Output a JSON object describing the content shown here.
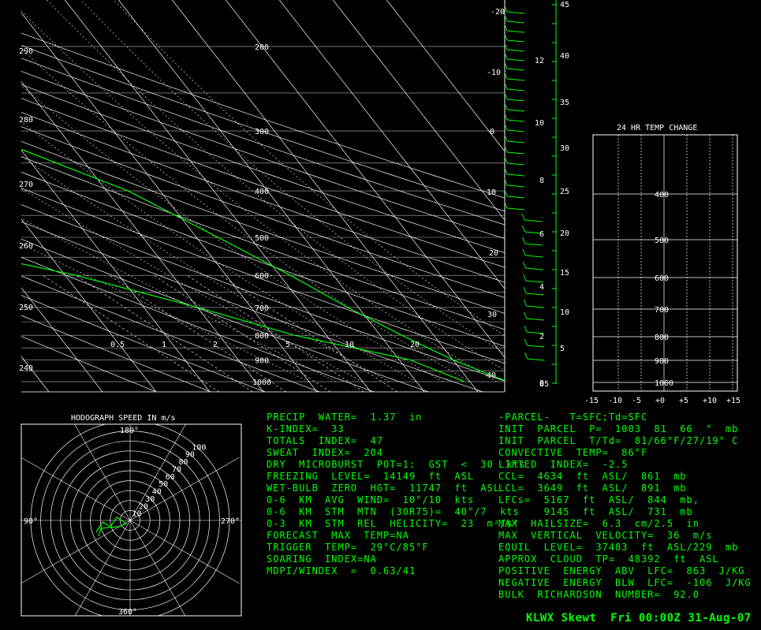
{
  "footer": "KLWX Skewt  Fri 00:00Z 31-Aug-07",
  "hodograph": {
    "title": "HODOGRAPH SPEED IN m/s",
    "dir_labels": [
      "180°",
      "90°",
      "270°",
      "360°"
    ],
    "ring_labels": [
      "10",
      "20",
      "30",
      "40",
      "50",
      "60",
      "70",
      "80",
      "90",
      "100"
    ]
  },
  "temp_change": {
    "title": "24 HR TEMP CHANGE",
    "pressure_labels": [
      "400",
      "500",
      "600",
      "700",
      "800",
      "900",
      "1000"
    ],
    "x_labels": [
      "-15",
      "-10",
      "-5",
      "+0",
      "+5",
      "+10",
      "+15"
    ]
  },
  "indices_left": [
    "PRECIP  WATER=  1.37  in",
    "K-INDEX=  33",
    "TOTALS  INDEX=  47",
    "SWEAT  INDEX=  204",
    "DRY  MICROBURST  POT=1:  GST  <  30  kts",
    "FREEZING  LEVEL=  14149  ft  ASL",
    "WET-BULB  ZERO  HGT=  11747  ft  ASL",
    "0-6  KM  AVG  WIND=  10°/10  kts",
    "0-6  KM  STM  MTN  (30R75)=  40°/7  kts",
    "0-3  KM  STM  REL  HELICITY=  23  m²/s²",
    "FORECAST  MAX  TEMP=NA",
    "TRIGGER  TEMP=  29°C/85°F",
    "SOARING  INDEX=NA",
    "MDPI/WINDEX  =  0.63/41"
  ],
  "indices_right": [
    "-PARCEL-   T=SFC;Td=SFC",
    "INIT  PARCEL  P=  1003  81  66  °  mb",
    "INIT  PARCEL  T/Td=  81/66°F/27/19° C",
    "CONVECTIVE  TEMP=  86°F",
    "LIFTED  INDEX=  -2.5",
    "CCL=  4634  ft  ASL/  861  mb",
    "LCL=  3649  ft  ASL/  891  mb",
    "LFCs=  5167  ft  ASL/  844  mb,",
    "       9145  ft  ASL/  731  mb",
    "MAX  HAILSIZE=  6.3  cm/2.5  in",
    "MAX  VERTICAL  VELOCITY=  36  m/s",
    "EQUIL  LEVEL=  37483  ft  ASL/229  mb",
    "APPROX  CLOUD  TP=  48392  ft  ASL",
    "POSITIVE  ENERGY  ABV  LFC=  863  J/KG",
    "NEGATIVE  ENERGY  BLW  LFC=  -106  J/KG",
    "BULK  RICHARDSON  NUMBER=  92.0"
  ],
  "chart_data": {
    "type": "line",
    "title": "",
    "pressure_levels": [
      200,
      300,
      400,
      500,
      600,
      700,
      800,
      900,
      1000
    ],
    "theta_labels": [
      "290",
      "280",
      "270",
      "260",
      "250",
      "240"
    ],
    "mixing_ratio_labels": [
      "0.5",
      "1",
      "2",
      "5",
      "10",
      "20"
    ],
    "temp_labels": [
      "-20",
      "-10",
      "0",
      "10",
      "20",
      "30",
      "40"
    ],
    "height_km_labels": [
      "12",
      "10",
      "8",
      "6",
      "4",
      "2",
      "0"
    ],
    "height_kft_labels": [
      "45",
      "40",
      "35",
      "30",
      "25",
      "20",
      "15",
      "10",
      "5"
    ],
    "bottom_right_label": "85",
    "series": [
      {
        "name": "",
        "values": [
          [
            -24,
            160
          ],
          [
            -28,
            200
          ],
          [
            -36,
            300
          ],
          [
            -16,
            400
          ],
          [
            -6,
            500
          ],
          [
            2,
            600
          ],
          [
            8,
            700
          ],
          [
            14,
            800
          ],
          [
            20,
            900
          ],
          [
            27,
            1000
          ]
        ]
      },
      {
        "name": "",
        "values": [
          [
            -30,
            160
          ],
          [
            -36,
            200
          ],
          [
            -44,
            300
          ],
          [
            -52,
            400
          ],
          [
            -66,
            500
          ],
          [
            -38,
            600
          ],
          [
            -20,
            700
          ],
          [
            -6,
            800
          ],
          [
            12,
            900
          ],
          [
            19,
            1000
          ]
        ]
      }
    ]
  }
}
